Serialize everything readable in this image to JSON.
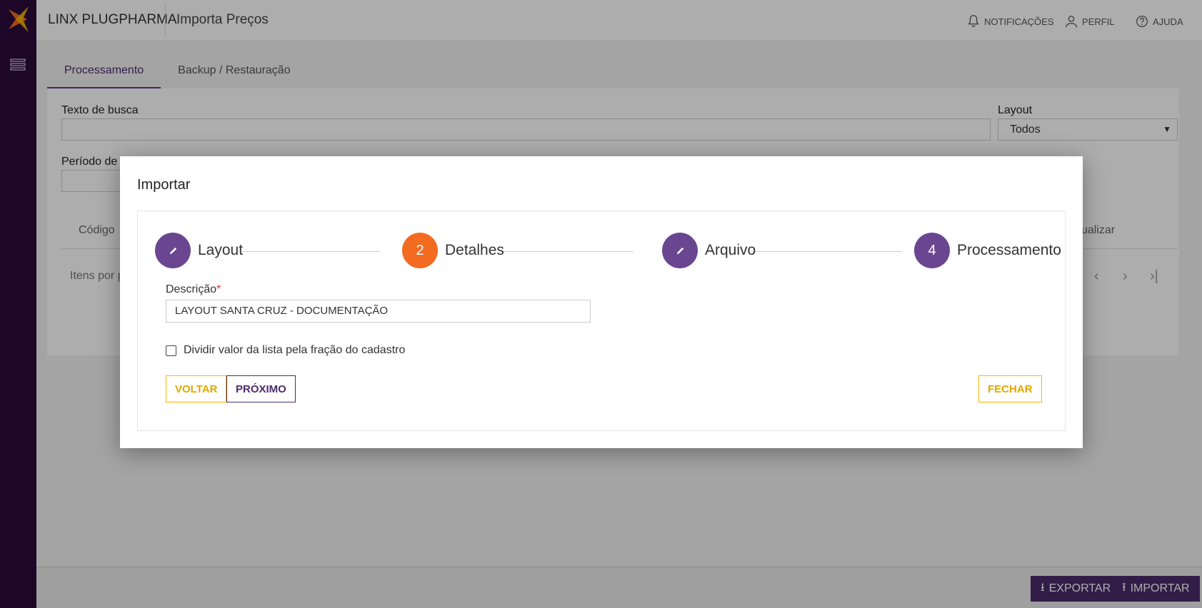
{
  "header": {
    "brand": "LINX PLUGPHARMA",
    "page_title": "Importa Preços",
    "notifications_label": "NOTIFICAÇÕES",
    "profile_label": "PERFIL",
    "help_label": "AJUDA"
  },
  "tabs": [
    {
      "label": "Processamento",
      "active": true
    },
    {
      "label": "Backup / Restauração",
      "active": false
    }
  ],
  "filters": {
    "search_label": "Texto de busca",
    "search_value": "",
    "layout_label": "Layout",
    "layout_value": "Todos",
    "period_label": "Período de c"
  },
  "table": {
    "col_code": "Código",
    "col_view": "sualizar",
    "items_per_page_label": "Itens por p"
  },
  "footer": {
    "export_label": "EXPORTAR",
    "import_label": "IMPORTAR"
  },
  "modal": {
    "title": "Importar",
    "steps": [
      {
        "label": "Layout",
        "marker": "pencil-icon",
        "state": "done"
      },
      {
        "label": "Detalhes",
        "marker": "2",
        "state": "current"
      },
      {
        "label": "Arquivo",
        "marker": "pencil-icon",
        "state": "done"
      },
      {
        "label": "Processamento",
        "marker": "4",
        "state": "pending"
      }
    ],
    "description_label": "Descrição",
    "required_mark": "*",
    "description_value": "LAYOUT SANTA CRUZ - DOCUMENTAÇÃO",
    "checkbox_label": "Dividir valor da lista pela fração do cadastro",
    "checkbox_checked": false,
    "back_label": "VOLTAR",
    "next_label": "PRÓXIMO",
    "close_label": "FECHAR"
  },
  "colors": {
    "sidebar": "#2a0b3d",
    "primary": "#4b2c6b",
    "step_done": "#6a4691",
    "step_current": "#f26b21",
    "accent_yellow": "#f5b800"
  }
}
